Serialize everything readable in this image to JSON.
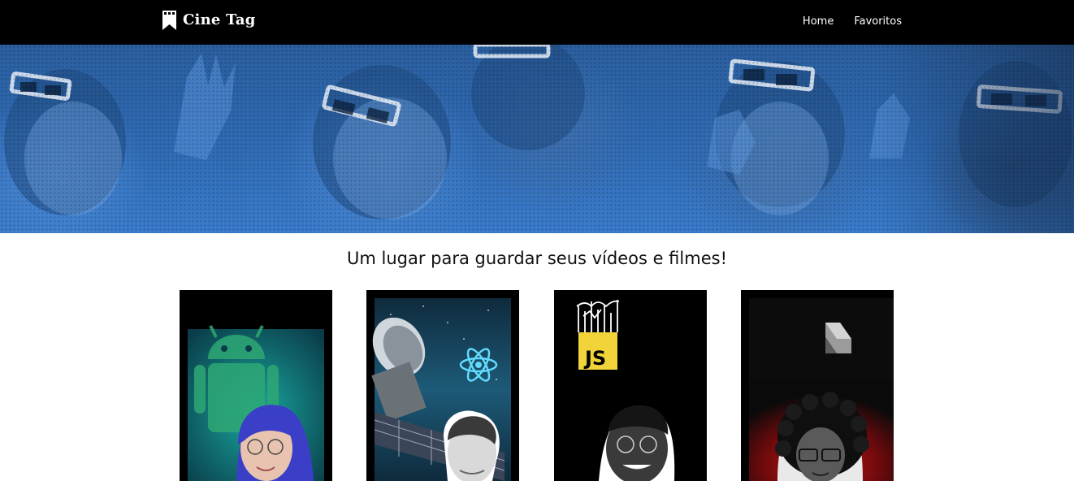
{
  "header": {
    "logo_text": "Cine Tag",
    "logo_icon": "bookmark-film-icon",
    "nav": [
      {
        "label": "Home"
      },
      {
        "label": "Favoritos"
      }
    ]
  },
  "banner": {
    "image": "audience-3d-glasses-banner"
  },
  "main": {
    "headline": "Um lugar para guardar seus vídeos e filmes!",
    "cards": [
      {
        "name": "video-card-android",
        "theme": "android",
        "accent": "#1fa9a0"
      },
      {
        "name": "video-card-react",
        "theme": "react",
        "accent": "#61dafb"
      },
      {
        "name": "video-card-javascript",
        "theme": "javascript",
        "label": "JS",
        "accent": "#f0d43a"
      },
      {
        "name": "video-card-dart",
        "theme": "dart",
        "accent": "#c4161c"
      }
    ]
  },
  "colors": {
    "header_bg": "#000000",
    "banner_blue": "#2f6ab3",
    "text_dark": "#111111"
  }
}
